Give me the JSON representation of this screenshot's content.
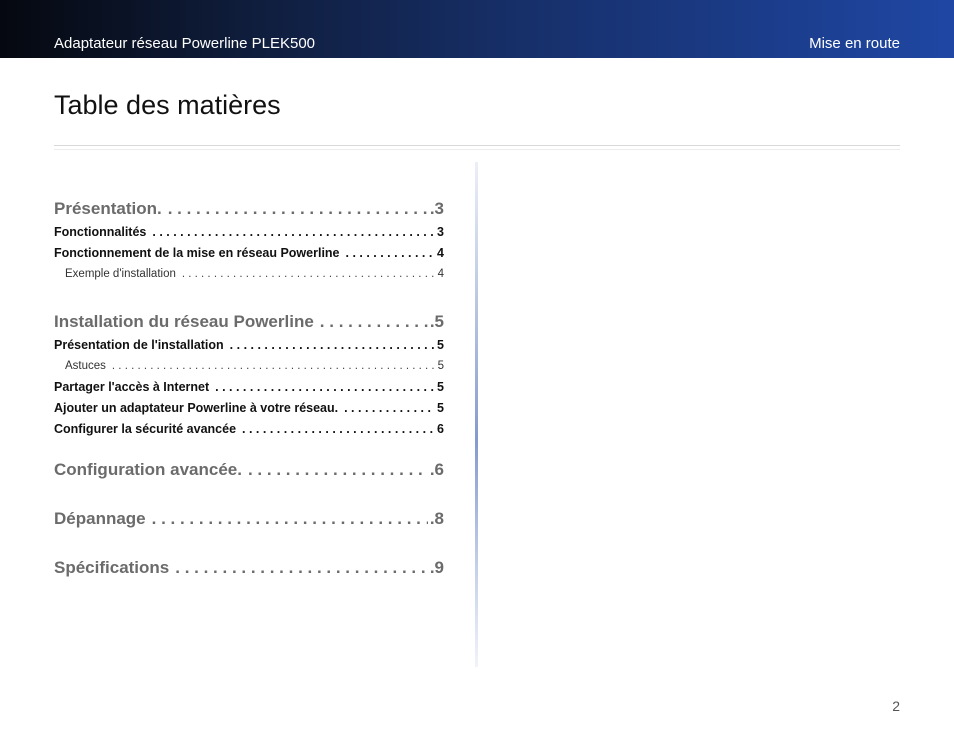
{
  "header": {
    "product_title": "Adaptateur réseau Powerline PLEK500",
    "section_title": "Mise en route"
  },
  "page": {
    "title": "Table des matières",
    "number": "2"
  },
  "toc": [
    {
      "level": 1,
      "label": "Présentation.",
      "page": ".3"
    },
    {
      "level": 2,
      "label": "Fonctionnalités",
      "page": "3"
    },
    {
      "level": 2,
      "label": "Fonctionnement de la mise en réseau Powerline",
      "page": "4"
    },
    {
      "level": 3,
      "label": "Exemple d'installation",
      "page": "4"
    },
    {
      "level": 1,
      "label": "Installation du réseau Powerline",
      "page": ".5"
    },
    {
      "level": 2,
      "label": "Présentation de l'installation",
      "page": "5"
    },
    {
      "level": 3,
      "label": "Astuces",
      "page": "5"
    },
    {
      "level": 2,
      "label": "Partager l'accès à Internet",
      "page": "5"
    },
    {
      "level": 2,
      "label": "Ajouter un adaptateur Powerline à votre réseau.",
      "page": "5"
    },
    {
      "level": 2,
      "label": "Configurer la sécurité avancée",
      "page": "6"
    },
    {
      "level": 1,
      "label": "Configuration avancée.",
      "page": ".6"
    },
    {
      "level": 1,
      "label": "Dépannage",
      "page": ".8"
    },
    {
      "level": 1,
      "label": "Spécifications",
      "page": ".9"
    }
  ]
}
